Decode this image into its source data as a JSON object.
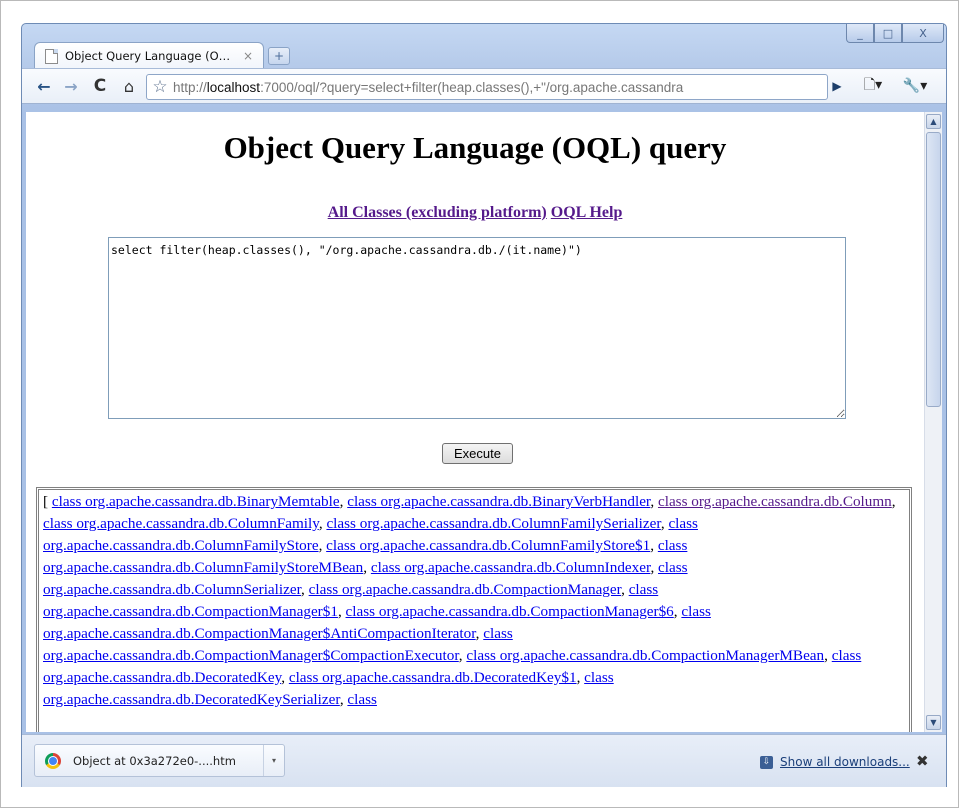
{
  "window": {
    "controls": [
      "_",
      "□",
      "X"
    ]
  },
  "tab": {
    "title": "Object Query Language (O…",
    "close": "×",
    "new_tab": "+"
  },
  "toolbar": {
    "back": "←",
    "forward": "→",
    "reload": "C",
    "home": "⌂",
    "star": "☆",
    "url_prefix": "http://",
    "url_host": "localhost",
    "url_rest": ":7000/oql/?query=select+filter(heap.classes(),+\"/org.apache.cassandra",
    "go": "▶",
    "page_menu": "🗋▾",
    "wrench_menu": "🔧▾"
  },
  "page": {
    "title": "Object Query Language (OQL) query",
    "link_all_classes": "All Classes (excluding platform)",
    "link_oql_help": "OQL Help",
    "query": "select filter(heap.classes(), \"/org.apache.cassandra.db./(it.name)\")",
    "execute_label": "Execute"
  },
  "results": {
    "open_bracket": "[",
    "items": [
      {
        "text": "class org.apache.cassandra.db.BinaryMemtable",
        "visited": false
      },
      {
        "text": "class org.apache.cassandra.db.BinaryVerbHandler",
        "visited": false
      },
      {
        "text": "class org.apache.cassandra.db.Column",
        "visited": true
      },
      {
        "text": "class org.apache.cassandra.db.ColumnFamily",
        "visited": false
      },
      {
        "text": "class org.apache.cassandra.db.ColumnFamilySerializer",
        "visited": false
      },
      {
        "text": "class org.apache.cassandra.db.ColumnFamilyStore",
        "visited": false
      },
      {
        "text": "class org.apache.cassandra.db.ColumnFamilyStore$1",
        "visited": false
      },
      {
        "text": "class org.apache.cassandra.db.ColumnFamilyStoreMBean",
        "visited": false
      },
      {
        "text": "class org.apache.cassandra.db.ColumnIndexer",
        "visited": false
      },
      {
        "text": "class org.apache.cassandra.db.ColumnSerializer",
        "visited": false
      },
      {
        "text": "class org.apache.cassandra.db.CompactionManager",
        "visited": false
      },
      {
        "text": "class org.apache.cassandra.db.CompactionManager$1",
        "visited": false
      },
      {
        "text": "class org.apache.cassandra.db.CompactionManager$6",
        "visited": false
      },
      {
        "text": "class org.apache.cassandra.db.CompactionManager$AntiCompactionIterator",
        "visited": false
      },
      {
        "text": "class org.apache.cassandra.db.CompactionManager$CompactionExecutor",
        "visited": false
      },
      {
        "text": "class org.apache.cassandra.db.CompactionManagerMBean",
        "visited": false
      },
      {
        "text": "class org.apache.cassandra.db.DecoratedKey",
        "visited": false
      },
      {
        "text": "class org.apache.cassandra.db.DecoratedKey$1",
        "visited": false
      },
      {
        "text": "class org.apache.cassandra.db.DecoratedKeySerializer",
        "visited": false
      },
      {
        "text": "class",
        "visited": false
      }
    ]
  },
  "downloads": {
    "item_name": "Object at 0x3a272e0-....htm",
    "item_menu": "▾",
    "show_all": "Show all downloads...",
    "close": "✖"
  }
}
